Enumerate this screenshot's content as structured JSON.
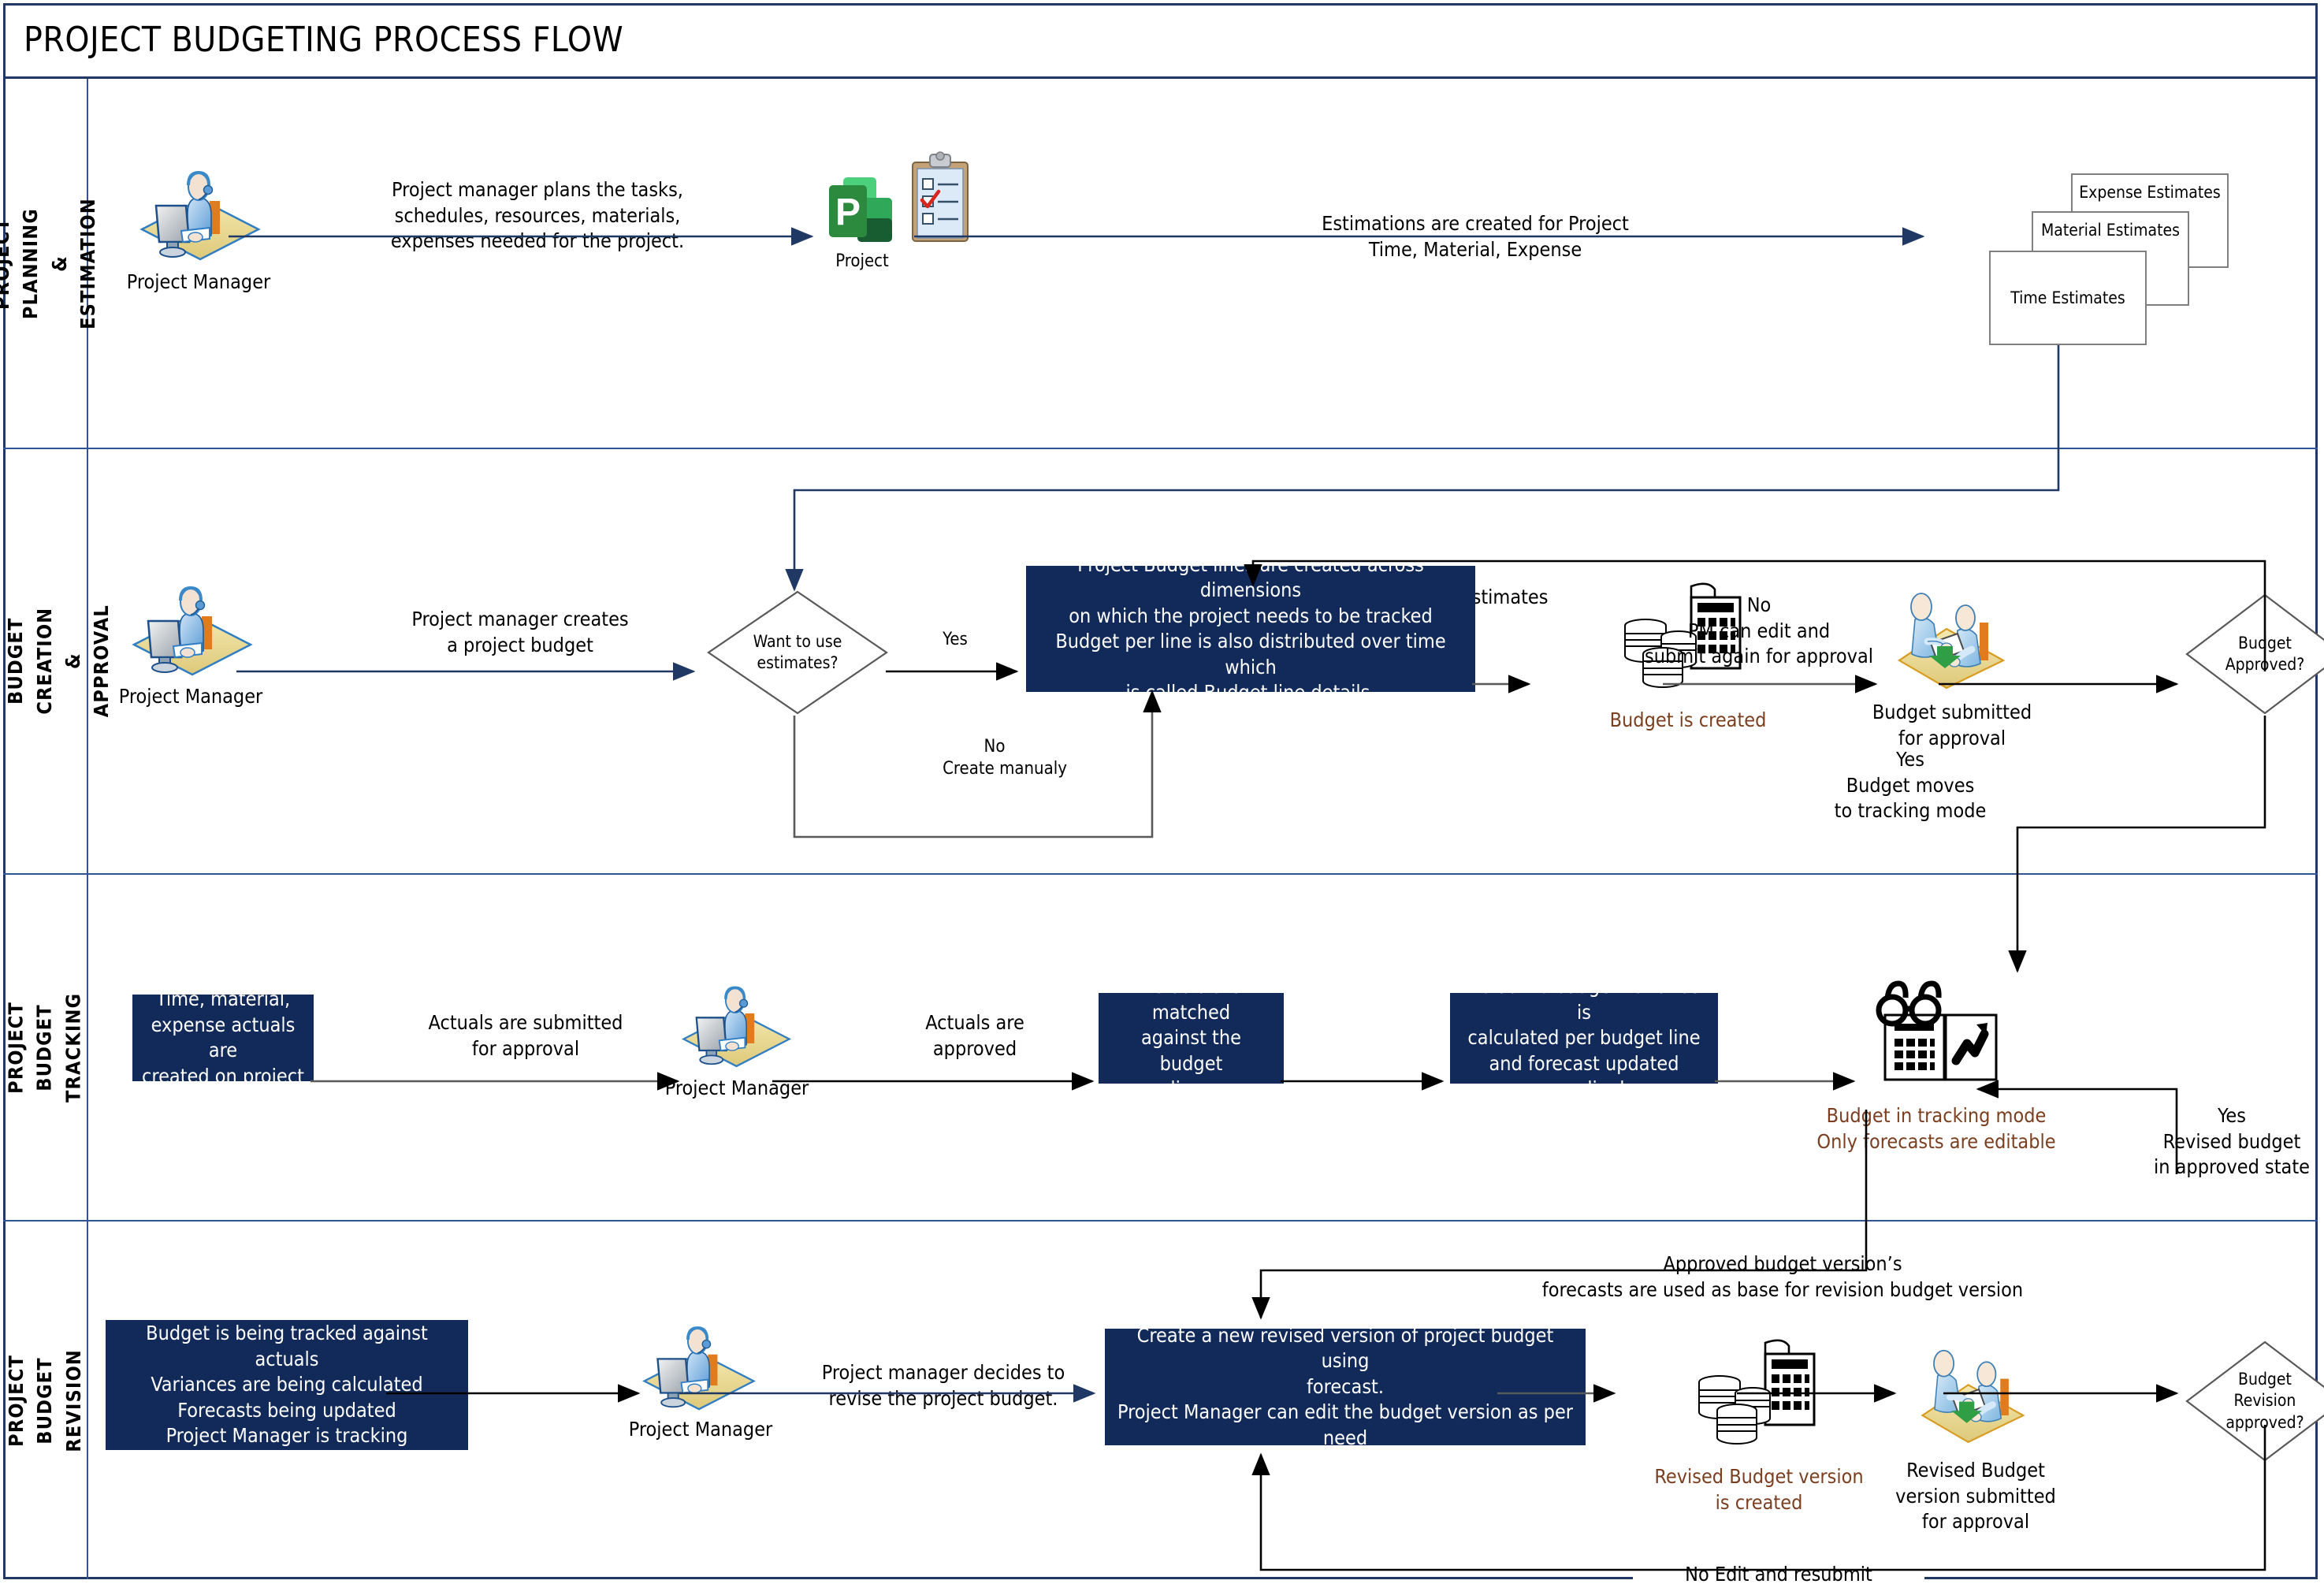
{
  "title": "PROJECT BUDGETING PROCESS FLOW",
  "colors": {
    "frame_border": "#1f3864",
    "lane_border": "#2e5496",
    "navy_box": "#122a59",
    "navy_box_text": "#ffffff",
    "brown_text": "#7b3f20",
    "connector_dark": "#1f3864",
    "connector_gray": "#595959",
    "doc_border": "#7f7f7f",
    "project_logo_green": "#31752f"
  },
  "lanes": [
    {
      "id": "planning",
      "label": "PROJECT PLANNING &\nESTIMATION"
    },
    {
      "id": "creation",
      "label": "PROJECT BUDGET\nCREATION & APPROVAL"
    },
    {
      "id": "tracking",
      "label": "PROJECT BUDGET\nTRACKING"
    },
    {
      "id": "revision",
      "label": "PROJECT BUDGET\nREVISION"
    }
  ],
  "lane1": {
    "actor_label": "Project Manager",
    "edge_plan": "Project manager plans the tasks,\nschedules, resources, materials,\nexpenses needed for the project.",
    "app_label": "Project",
    "edge_estimations": "Estimations are created for Project\nTime, Material, Expense",
    "estimates": [
      {
        "id": "expense",
        "label": "Expense Estimates"
      },
      {
        "id": "material",
        "label": "Material Estimates"
      },
      {
        "id": "time",
        "label": "Time Estimates"
      }
    ]
  },
  "lane2": {
    "actor_label": "Project Manager",
    "edge_creates": "Project manager creates\na project budget",
    "edge_use_estimates": "Use project estimates",
    "decision_estimates": "Want to use\nestimates?",
    "yes_label": "Yes",
    "no_label": "No",
    "no_create_manually": "Create manualy",
    "budget_lines_box": "Project Budget lines are created across dimensions\non which the project needs to be tracked\nBudget per line is also distributed over time which\nis called Budget line details.",
    "budget_created_label": "Budget is created",
    "budget_submitted_label": "Budget submitted\nfor approval",
    "decision_approved": "Budget\nApproved?",
    "no_pm_edit": "No\nPM can edit and\nsubmit again for approval",
    "yes_tracking": "Yes\nBudget moves\nto tracking mode"
  },
  "lane3": {
    "actuals_box": "Time, material,\nexpense actuals are\ncreated on project",
    "edge_submitted": "Actuals are submitted\nfor approval",
    "actor_label": "Project Manager",
    "edge_approved": "Actuals are\napproved",
    "matched_box": "Actuals are matched\nagainst the budget\nlines",
    "variance_box": "Actual vs budget variance is\ncalculated per budget line\nand forecast updated\naccordingly",
    "tracking_mode_label": "Budget in tracking mode\nOnly forecasts are editable",
    "yes_revised": "Yes\nRevised budget\nin approved state"
  },
  "lane4": {
    "tracked_box": "Budget is being tracked against actuals\nVariances are being calculated\nForecasts being updated\nProject Manager is tracking",
    "actor_label": "Project Manager",
    "edge_decides": "Project manager decides to\nrevise the project budget.",
    "revise_box": "Create a new revised version of project budget using\nforecast.\nProject Manager can edit the budget version as per\nneed",
    "edge_forecast_base": "Approved budget version’s\nforecasts are used as base for revision budget version",
    "revised_created_label": "Revised Budget version\nis created",
    "revised_submitted_label": "Revised Budget\nversion submitted\nfor approval",
    "decision_revision": "Budget\nRevision\napproved?",
    "no_edit_resubmit": "No Edit and resubmit"
  },
  "icons": {
    "project_manager": "person-at-computer-icon",
    "ms_project": "microsoft-project-logo-icon",
    "clipboard": "clipboard-checklist-icon",
    "calculator_coins": "calculator-with-coins-icon",
    "handover": "two-people-document-handover-icon",
    "tracking": "glasses-calculator-chart-icon"
  }
}
